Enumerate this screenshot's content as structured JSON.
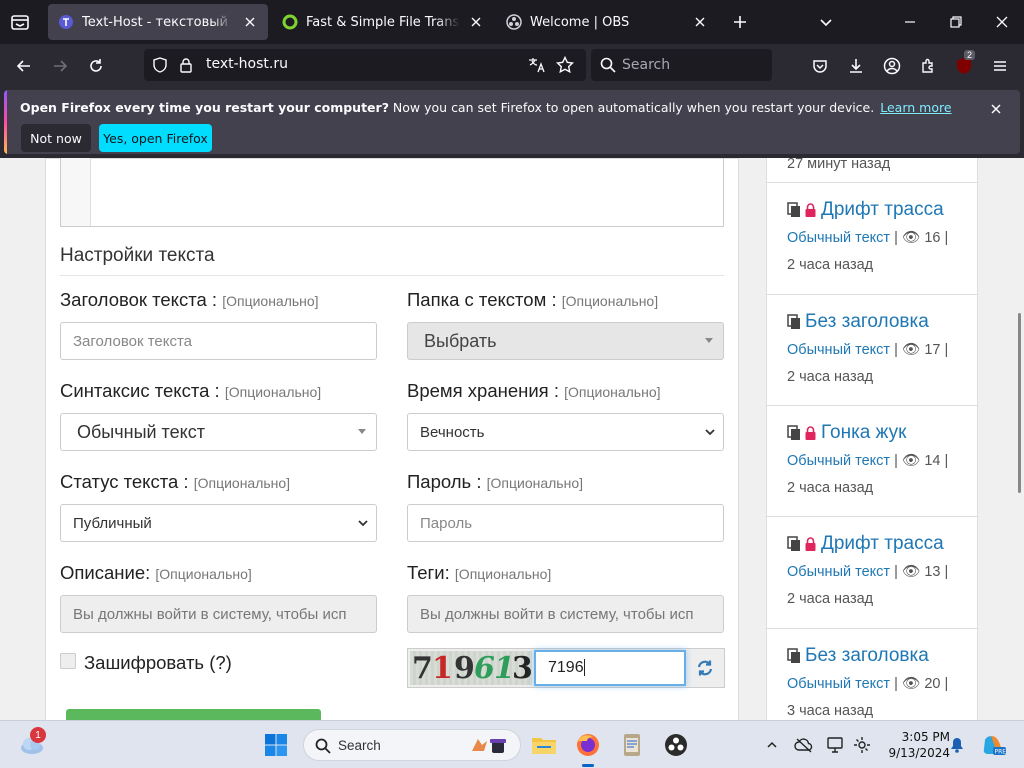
{
  "browser": {
    "tabs": [
      {
        "title": "Text-Host - текстовый хостинг",
        "active": true,
        "favicon": "text-host-favicon"
      },
      {
        "title": "Fast & Simple File Transfers - Fil",
        "active": false,
        "favicon": "transfer-favicon"
      },
      {
        "title": "Welcome | OBS",
        "active": false,
        "favicon": "obs-favicon"
      }
    ],
    "url": "text-host.ru",
    "search_placeholder": "Search",
    "extensions_badge": "2"
  },
  "notification": {
    "bold": "Open Firefox every time you restart your computer?",
    "text": " Now you can set Firefox to open automatically when you restart your device.",
    "link": "Learn more",
    "btn_not_now": "Not now",
    "btn_yes": "Yes, open Firefox"
  },
  "form": {
    "section_title": "Настройки текста",
    "optional": "[Опционально]",
    "title_label": "Заголовок текста :",
    "title_placeholder": "Заголовок текста",
    "folder_label": "Папка с текстом :",
    "folder_value": "Выбрать",
    "syntax_label": "Синтаксис текста :",
    "syntax_value": "Обычный текст",
    "expiry_label": "Время хранения :",
    "expiry_value": "Вечность",
    "status_label": "Статус текста :",
    "status_value": "Публичный",
    "password_label": "Пароль :",
    "password_placeholder": "Пароль",
    "desc_label": "Описание:",
    "desc_disabled": "Вы должны войти в систему, чтобы исп",
    "tags_label": "Теги:",
    "tags_disabled": "Вы должны войти в систему, чтобы исп",
    "encrypt_label": "Зашифровать (?)",
    "captcha_chars": [
      "7",
      "1",
      "9",
      "6",
      "1",
      "3"
    ],
    "captcha_input": "7196"
  },
  "sidebar": {
    "partial_top": "27 минут назад",
    "items": [
      {
        "title": "Дрифт трасса",
        "locked": true,
        "syntax": "Обычный текст",
        "views": "16",
        "time": "2 часа назад"
      },
      {
        "title": "Без заголовка",
        "locked": false,
        "syntax": "Обычный текст",
        "views": "17",
        "time": "2 часа назад"
      },
      {
        "title": "Гонка жук",
        "locked": true,
        "syntax": "Обычный текст",
        "views": "14",
        "time": "2 часа назад"
      },
      {
        "title": "Дрифт трасса",
        "locked": true,
        "syntax": "Обычный текст",
        "views": "13",
        "time": "2 часа назад"
      },
      {
        "title": "Без заголовка",
        "locked": false,
        "syntax": "Обычный текст",
        "views": "20",
        "time": "3 часа назад"
      }
    ]
  },
  "taskbar": {
    "search_placeholder": "Search",
    "weather_badge": "1",
    "time": "3:05 PM",
    "date": "9/13/2024"
  },
  "colors": {
    "accent_link": "#1f77b4",
    "lock": "#e0245e",
    "firefox_cyan": "#00ddff"
  }
}
